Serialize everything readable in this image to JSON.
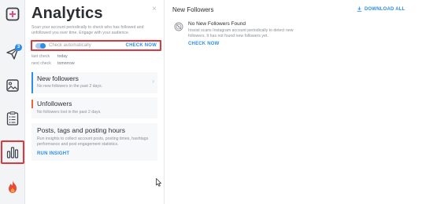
{
  "sidebar": {
    "items": [
      {
        "icon": "plus-square-icon",
        "badge": ""
      },
      {
        "icon": "send-icon",
        "badge": "3"
      },
      {
        "icon": "image-icon",
        "badge": ""
      },
      {
        "icon": "list-icon",
        "badge": ""
      },
      {
        "icon": "bar-chart-icon",
        "badge": "",
        "active": true
      },
      {
        "icon": "fire-icon",
        "badge": ""
      }
    ]
  },
  "panel": {
    "title": "Analytics",
    "close_glyph": "×",
    "description": "Scan your account periodically to check who has followed and unfollowed you over time. Engage with your audience.",
    "auto_check_label": "Check automatically",
    "check_now": "CHECK NOW",
    "last_check_label": "last check",
    "last_check_value": "today",
    "next_check_label": "next check",
    "next_check_value": "tomorrow"
  },
  "cards": {
    "new_followers": {
      "title": "New followers",
      "text": "No new followers in the past 2 days.",
      "chevron": "›"
    },
    "unfollowers": {
      "title": "Unfollowers",
      "text": "No followers lost in the past 2 days."
    },
    "posts": {
      "title": "Posts, tags and posting hours",
      "text": "Run insights to collect account posts, posting times, hashtags performance and post engagement statistics.",
      "link": "RUN INSIGHT"
    }
  },
  "main": {
    "title": "New Followers",
    "download": "DOWNLOAD ALL",
    "empty_title": "No New Followers Found",
    "empty_text": "Inssist scans Instagram account periodically to detect new followers. It has not found new followers yet.",
    "empty_link": "CHECK NOW"
  },
  "colors": {
    "accent": "#2c8ee8",
    "highlight": "#d9393f",
    "new_followers_bar": "#2c8ee8",
    "unfollowers_bar": "#e8643c"
  }
}
